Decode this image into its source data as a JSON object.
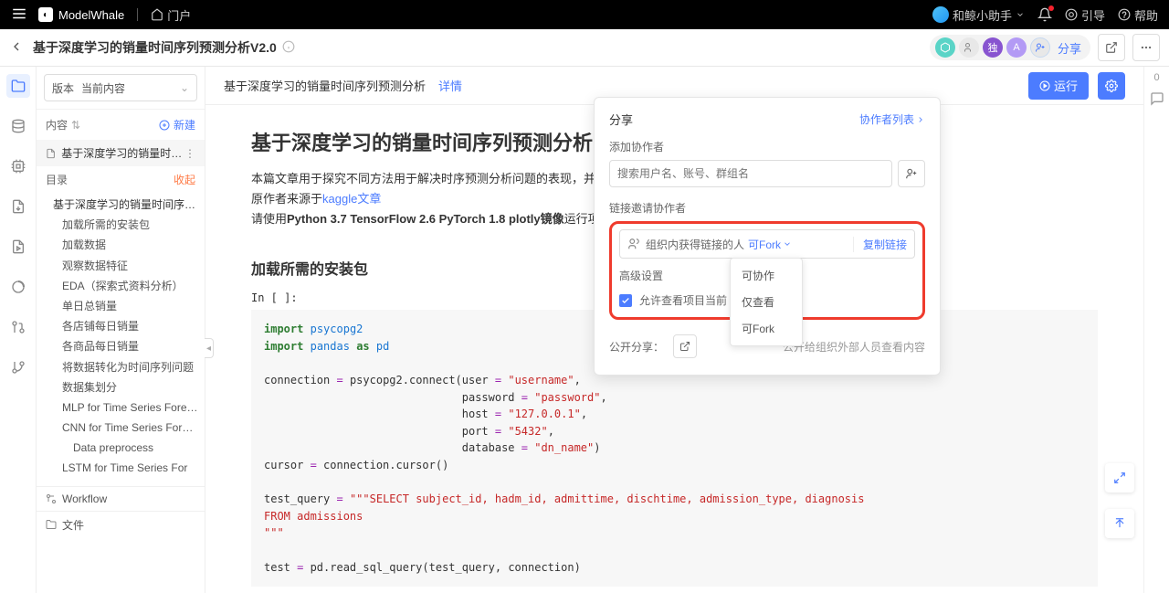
{
  "topbar": {
    "brand": "ModelWhale",
    "portal": "门户",
    "assistant": "和鲸小助手",
    "guide": "引导",
    "help": "帮助"
  },
  "subheader": {
    "title": "基于深度学习的销量时间序列预测分析V2.0",
    "share": "分享",
    "badge_private": "独",
    "badge_a": "A"
  },
  "sidepanel": {
    "version_label": "版本",
    "version_value": "当前内容",
    "content_label": "内容",
    "new_label": "新建",
    "file_name": "基于深度学习的销量时间…",
    "outline_label": "目录",
    "collapse_label": "收起",
    "toc": {
      "root": "基于深度学习的销量时间序列预测分析",
      "items": [
        "加载所需的安装包",
        "加载数据",
        "观察数据特征",
        "EDA（探索式资料分析）",
        "单日总销量",
        "各店铺每日销量",
        "各商品每日销量",
        "将数据转化为时间序列问题",
        "数据集划分",
        "MLP for Time Series Forecasting",
        "CNN for Time Series Forecasting",
        "Data preprocess",
        "LSTM for Time Series For"
      ]
    },
    "workflow": "Workflow",
    "files": "文件"
  },
  "maintop": {
    "crumb": "基于深度学习的销量时间序列预测分析",
    "detail": "详情",
    "run": "运行"
  },
  "content": {
    "h1": "基于深度学习的销量时间序列预测分析",
    "p1": "本篇文章用于探究不同方法用于解决时序预测分析问题的表现，并将训练成果以模型服务的形式发布",
    "p2_prefix": "原作者来源于",
    "p2_link": "kaggle文章",
    "p3_prefix": "请使用",
    "p3_bold": "Python 3.7 TensorFlow 2.6 PyTorch 1.8 plotly镜像",
    "p3_suffix": "运行项目",
    "h2": "加载所需的安装包",
    "prompt": "In [ ]:",
    "code": "import psycopg2\nimport pandas as pd\n\nconnection = psycopg2.connect(user = \"username\",\n                              password = \"password\",\n                              host = \"127.0.0.1\",\n                              port = \"5432\",\n                              database = \"dn_name\")\ncursor = connection.cursor()\n\ntest_query = \"\"\"SELECT subject_id, hadm_id, admittime, dischtime, admission_type, diagnosis\nFROM admissions\n\"\"\"\n\ntest = pd.read_sql_query(test_query, connection)"
  },
  "popover": {
    "title": "分享",
    "collab_list": "协作者列表",
    "add_label": "添加协作者",
    "search_placeholder": "搜索用户名、账号、群组名",
    "link_invite_label": "链接邀请协作者",
    "link_scope": "组织内获得链接的人",
    "link_perm": "可Fork",
    "copy_link": "复制链接",
    "adv_label": "高级设置",
    "allow_view": "允许查看项目当前",
    "options": {
      "o1": "可协作",
      "o2": "仅查看",
      "o3": "可Fork"
    },
    "public_label": "公开分享：",
    "public_desc": "公开给组织外部人员查看内容"
  },
  "rightrail": {
    "count": "0"
  }
}
